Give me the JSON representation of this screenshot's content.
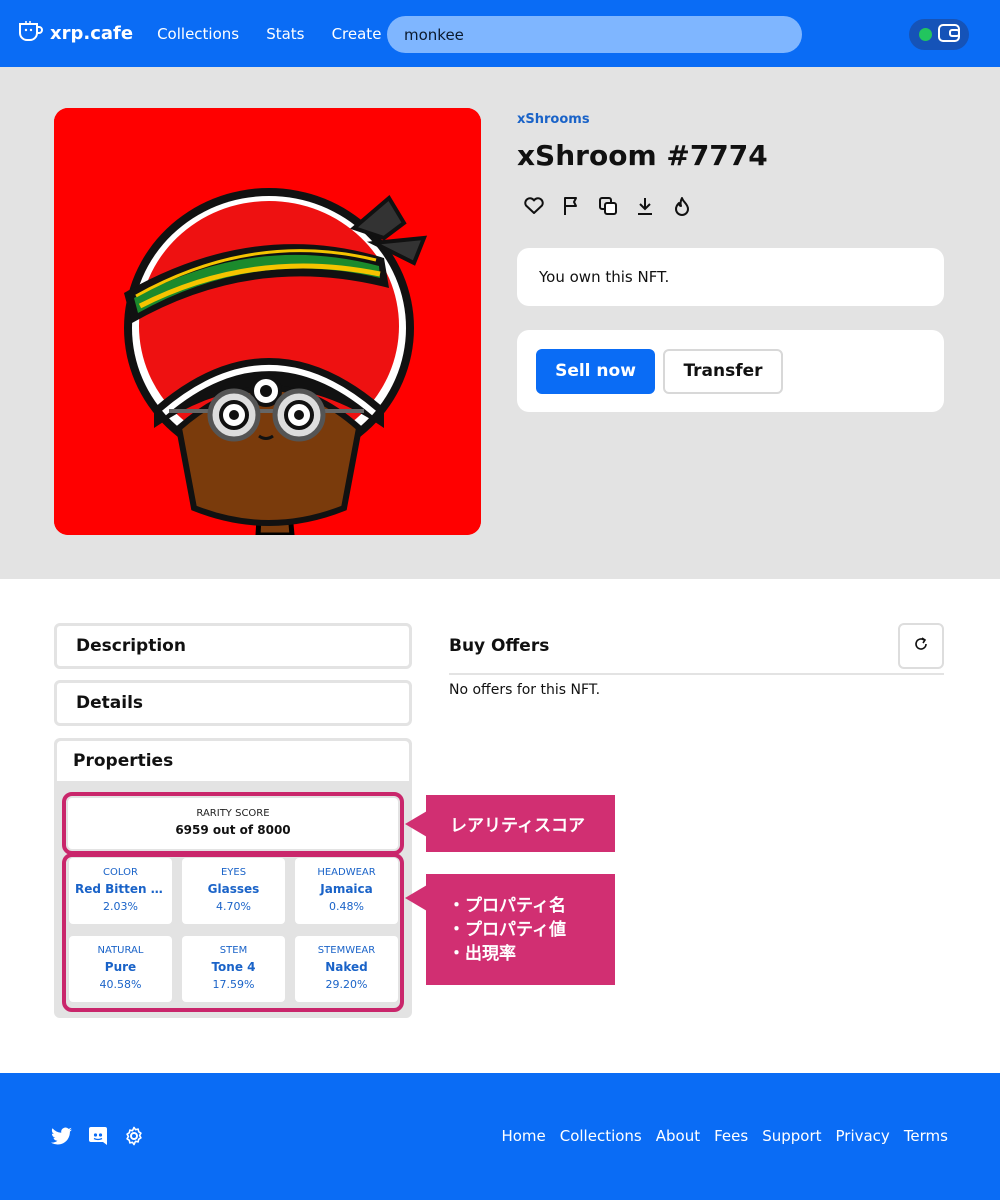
{
  "header": {
    "logo": "xrp.cafe",
    "nav": [
      "Collections",
      "Stats",
      "Create"
    ],
    "search_value": "monkee"
  },
  "nft": {
    "collection": "xShrooms",
    "title": "xShroom #7774",
    "ownership_note": "You own this NFT.",
    "sell_label": "Sell now",
    "transfer_label": "Transfer"
  },
  "accordion": {
    "description": "Description",
    "details": "Details",
    "properties": "Properties"
  },
  "rarity": {
    "label": "RARITY SCORE",
    "value": "6959 out of 8000"
  },
  "properties": [
    {
      "name": "COLOR",
      "value": "Red Bitten Bl...",
      "rate": "2.03%"
    },
    {
      "name": "EYES",
      "value": "Glasses",
      "rate": "4.70%"
    },
    {
      "name": "HEADWEAR",
      "value": "Jamaica",
      "rate": "0.48%"
    },
    {
      "name": "NATURAL",
      "value": "Pure",
      "rate": "40.58%"
    },
    {
      "name": "STEM",
      "value": "Tone 4",
      "rate": "17.59%"
    },
    {
      "name": "STEMWEAR",
      "value": "Naked",
      "rate": "29.20%"
    }
  ],
  "annotations": {
    "rarity_callout": "レアリティスコア",
    "props_callout": [
      "・プロパティ名",
      "・プロパティ値",
      "・出現率"
    ]
  },
  "offers": {
    "title": "Buy Offers",
    "empty": "No offers for this NFT."
  },
  "footer": {
    "links": [
      "Home",
      "Collections",
      "About",
      "Fees",
      "Support",
      "Privacy",
      "Terms"
    ]
  },
  "colors": {
    "brand_blue": "#0a6cf5",
    "accent_pink": "#d12f72",
    "artwork_bg": "#ff0000"
  },
  "icons": [
    "cup-logo-icon",
    "wallet-icon",
    "heart-icon",
    "flag-icon",
    "copy-icon",
    "download-icon",
    "flame-icon",
    "refresh-icon",
    "twitter-icon",
    "discord-icon",
    "settings-icon"
  ]
}
